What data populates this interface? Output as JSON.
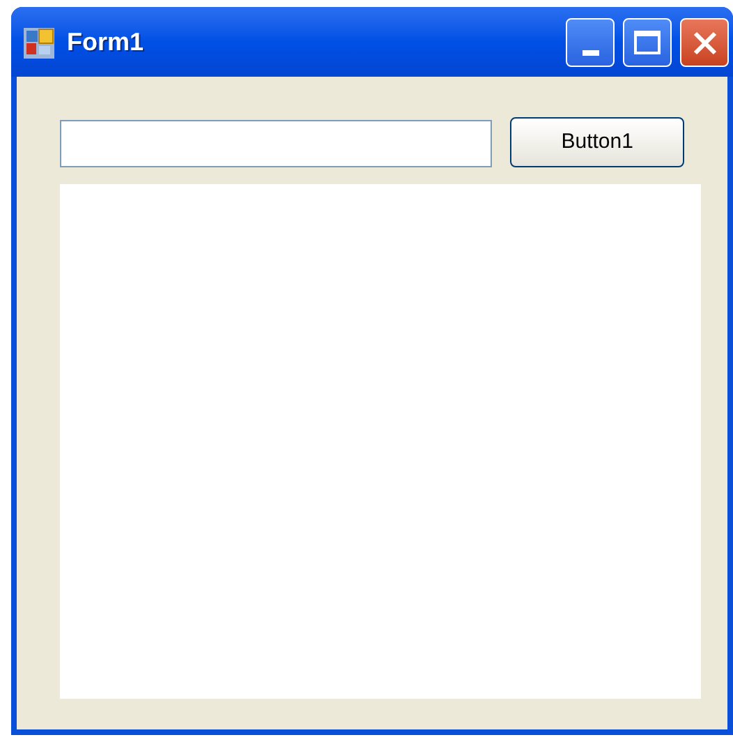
{
  "window": {
    "title": "Form1"
  },
  "button": {
    "label": "Button1"
  }
}
